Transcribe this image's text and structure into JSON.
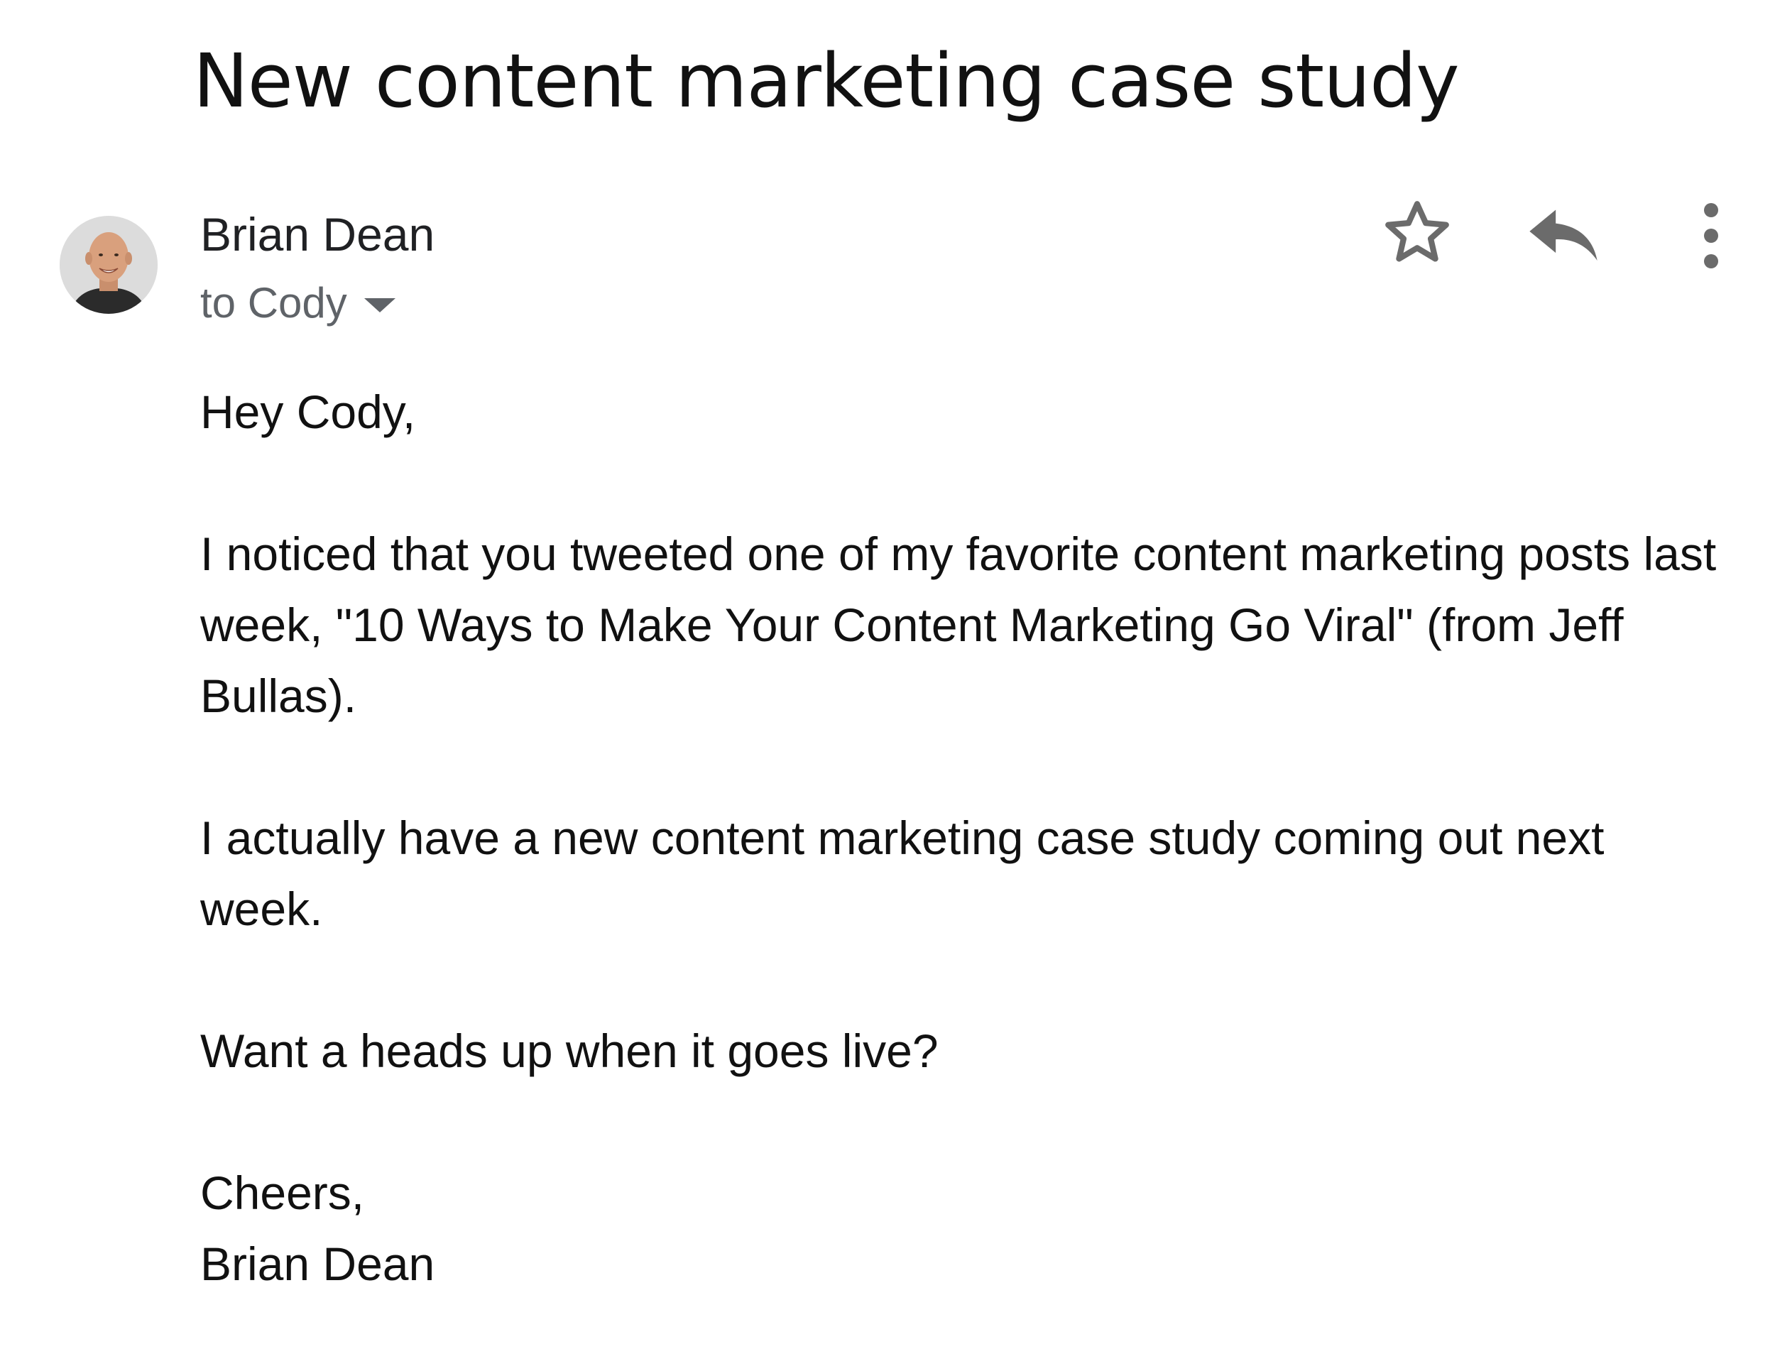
{
  "email": {
    "subject": "New content marketing case study",
    "sender": {
      "name": "Brian Dean",
      "avatar": "sender-avatar-photo"
    },
    "recipient_label": "to Cody",
    "actions": {
      "star_icon": "star-outline-icon",
      "reply_icon": "reply-arrow-icon",
      "more_icon": "more-vertical-icon"
    },
    "body": {
      "greeting": "Hey Cody,",
      "paragraph_1": "I noticed that you tweeted one of my favorite content marketing posts last week, \"10 Ways to Make Your Content Marketing Go Viral\" (from Jeff Bullas).",
      "paragraph_2": "I actually have a new content marketing case study coming out next week.",
      "paragraph_3": "Want a heads up when it goes live?",
      "signoff": "Cheers,",
      "signature": "Brian Dean"
    }
  },
  "colors": {
    "icon_gray": "#6b6b6b",
    "secondary_text": "#5f6368"
  }
}
